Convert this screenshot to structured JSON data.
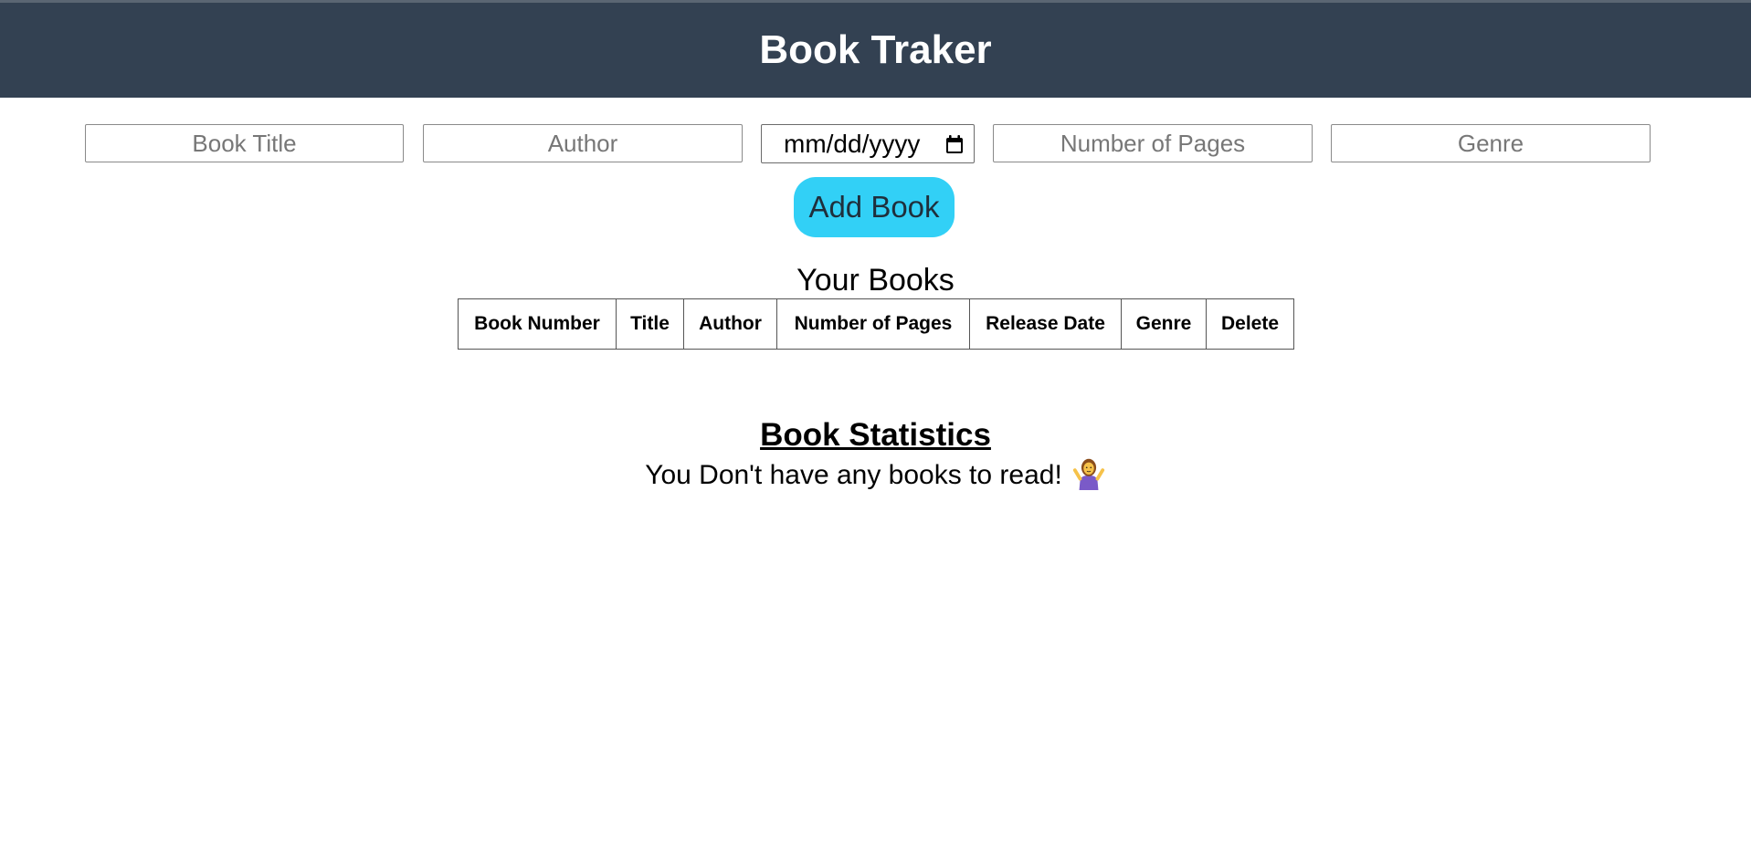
{
  "header": {
    "title": "Book Traker"
  },
  "form": {
    "title_placeholder": "Book Title",
    "author_placeholder": "Author",
    "date_value": "mm/dd/yyyy",
    "pages_placeholder": "Number of Pages",
    "genre_placeholder": "Genre",
    "add_label": "Add Book"
  },
  "books": {
    "heading": "Your Books",
    "columns": [
      "Book Number",
      "Title",
      "Author",
      "Number of Pages",
      "Release Date",
      "Genre",
      "Delete"
    ],
    "rows": []
  },
  "stats": {
    "heading": "Book Statistics",
    "empty_message": "You Don't have any books to read!",
    "empty_icon": "person-shrugging-icon"
  },
  "colors": {
    "header_bg": "#334152",
    "button_bg": "#32d0f6"
  }
}
